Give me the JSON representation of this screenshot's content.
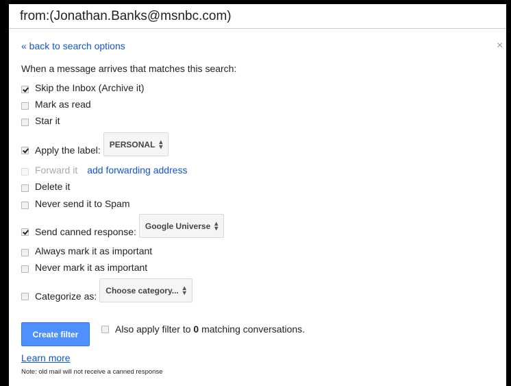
{
  "search_query": "from:(Jonathan.Banks@msnbc.com)",
  "back_link": "« back to search options",
  "close_symbol": "×",
  "heading": "When a message arrives that matches this search:",
  "options": [
    {
      "label": "Skip the Inbox (Archive it)",
      "checked": true
    },
    {
      "label": "Mark as read",
      "checked": false
    },
    {
      "label": "Star it",
      "checked": false
    },
    {
      "label": "Apply the label:",
      "checked": true,
      "select": "PERSONAL"
    },
    {
      "label": "Forward it",
      "checked": false,
      "disabled": true,
      "link": "add forwarding address"
    },
    {
      "label": "Delete it",
      "checked": false
    },
    {
      "label": "Never send it to Spam",
      "checked": false
    },
    {
      "label": "Send canned response:",
      "checked": true,
      "select": "Google Universe"
    },
    {
      "label": "Always mark it as important",
      "checked": false
    },
    {
      "label": "Never mark it as important",
      "checked": false
    },
    {
      "label": "Categorize as:",
      "checked": false,
      "select": "Choose category..."
    }
  ],
  "create_button": "Create filter",
  "also_apply": {
    "prefix": "Also apply filter to ",
    "count": "0",
    "suffix": " matching conversations.",
    "checked": false
  },
  "learn_more": "Learn more",
  "note": "Note: old mail will not receive a canned response"
}
